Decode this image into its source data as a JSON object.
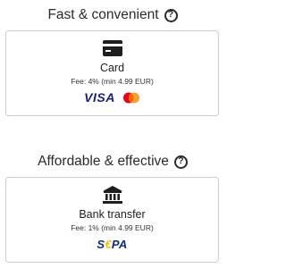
{
  "sections": [
    {
      "heading": "Fast & convenient",
      "help_glyph": "?",
      "option": {
        "icon": "credit-card-icon",
        "title": "Card",
        "fee": "Fee: 4% (min 4.99 EUR)",
        "logos": {
          "visa": "VISA",
          "mastercard": "mastercard-icon"
        }
      }
    },
    {
      "heading": "Affordable & effective",
      "help_glyph": "?",
      "option": {
        "icon": "bank-icon",
        "title": "Bank transfer",
        "fee": "Fee: 1% (min 4.99 EUR)",
        "logos": {
          "sepa_left": "S",
          "sepa_mark": "€",
          "sepa_right": "PA"
        }
      }
    }
  ],
  "colors": {
    "visa_blue": "#1a1f71",
    "mastercard_red": "#eb001b",
    "mastercard_orange": "#f79e1b",
    "sepa_blue": "#10298e",
    "sepa_yellow": "#f8c300",
    "card_border": "#cfcfcf"
  }
}
